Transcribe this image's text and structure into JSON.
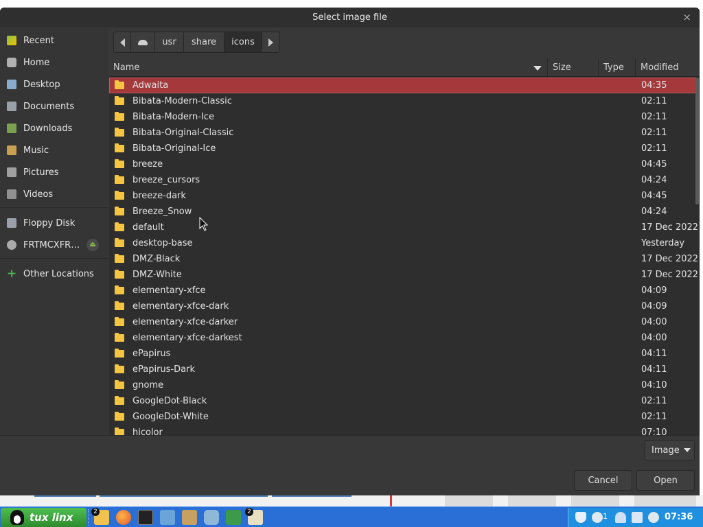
{
  "dialog": {
    "title": "Select image file",
    "close_glyph": "×"
  },
  "sidebar": {
    "items": [
      {
        "label": "Recent",
        "icon": "recent-icon"
      },
      {
        "label": "Home",
        "icon": "home-icon"
      },
      {
        "label": "Desktop",
        "icon": "desktop-icon"
      },
      {
        "label": "Documents",
        "icon": "documents-icon"
      },
      {
        "label": "Downloads",
        "icon": "downloads-icon"
      },
      {
        "label": "Music",
        "icon": "music-icon"
      },
      {
        "label": "Pictures",
        "icon": "pictures-icon"
      },
      {
        "label": "Videos",
        "icon": "videos-icon"
      },
      {
        "label": "Floppy Disk",
        "icon": "floppy-icon"
      },
      {
        "label": "FRTMCXFR…",
        "icon": "drive-icon"
      },
      {
        "label": "Other Locations",
        "icon": "plus-icon"
      }
    ]
  },
  "pathbar": {
    "segments": [
      "usr",
      "share",
      "icons"
    ],
    "active": "icons"
  },
  "columns": {
    "name": "Name",
    "size": "Size",
    "type": "Type",
    "modified": "Modified"
  },
  "files": [
    {
      "name": "Adwaita",
      "modified": "04:35",
      "selected": true
    },
    {
      "name": "Bibata-Modern-Classic",
      "modified": "02:11"
    },
    {
      "name": "Bibata-Modern-Ice",
      "modified": "02:11"
    },
    {
      "name": "Bibata-Original-Classic",
      "modified": "02:11"
    },
    {
      "name": "Bibata-Original-Ice",
      "modified": "02:11"
    },
    {
      "name": "breeze",
      "modified": "04:45"
    },
    {
      "name": "breeze_cursors",
      "modified": "04:24"
    },
    {
      "name": "breeze-dark",
      "modified": "04:45"
    },
    {
      "name": "Breeze_Snow",
      "modified": "04:24"
    },
    {
      "name": "default",
      "modified": "17 Dec 2022"
    },
    {
      "name": "desktop-base",
      "modified": "Yesterday"
    },
    {
      "name": "DMZ-Black",
      "modified": "17 Dec 2022"
    },
    {
      "name": "DMZ-White",
      "modified": "17 Dec 2022"
    },
    {
      "name": "elementary-xfce",
      "modified": "04:09"
    },
    {
      "name": "elementary-xfce-dark",
      "modified": "04:09"
    },
    {
      "name": "elementary-xfce-darker",
      "modified": "04:00"
    },
    {
      "name": "elementary-xfce-darkest",
      "modified": "04:00"
    },
    {
      "name": "ePapirus",
      "modified": "04:11"
    },
    {
      "name": "ePapirus-Dark",
      "modified": "04:11"
    },
    {
      "name": "gnome",
      "modified": "04:10"
    },
    {
      "name": "GoogleDot-Black",
      "modified": "02:11"
    },
    {
      "name": "GoogleDot-White",
      "modified": "02:11"
    },
    {
      "name": "hicolor",
      "modified": "07:10"
    }
  ],
  "filter": {
    "label": "Image"
  },
  "buttons": {
    "cancel": "Cancel",
    "open": "Open"
  },
  "taskbar": {
    "start_label": "tux linx",
    "badges": {
      "files": "2",
      "multi": "2"
    },
    "tray_badge": "1",
    "clock": "07:36"
  },
  "colors": {
    "selection": "#a4383a",
    "folder": "#f5c542",
    "taskbar": "#2a6fd6",
    "start": "#3aa83a"
  }
}
